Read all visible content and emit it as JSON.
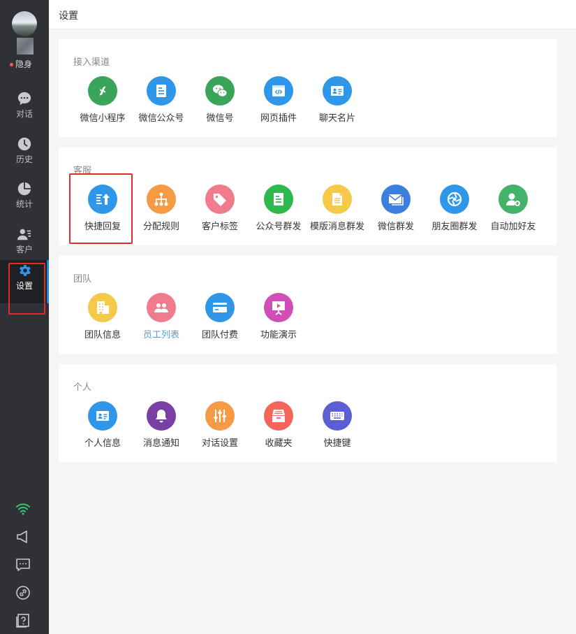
{
  "sidebar": {
    "status": "隐身",
    "items": [
      {
        "label": "对话",
        "icon": "chat-icon"
      },
      {
        "label": "历史",
        "icon": "clock-icon"
      },
      {
        "label": "统计",
        "icon": "pie-chart-icon"
      },
      {
        "label": "客户",
        "icon": "contacts-icon"
      },
      {
        "label": "设置",
        "icon": "gear-icon"
      }
    ],
    "bottom_icons": [
      "wifi-icon",
      "megaphone-icon",
      "message-icon",
      "link-icon",
      "help-icon"
    ],
    "colors": {
      "background": "#2f3136",
      "active": "#1f2024",
      "wifi": "#2ecc71"
    }
  },
  "header": {
    "title": "设置"
  },
  "sections": [
    {
      "title": "接入渠道",
      "items": [
        {
          "label": "微信小程序",
          "icon": "mini-program-icon",
          "color": "#3aa55a"
        },
        {
          "label": "微信公众号",
          "icon": "official-account-icon",
          "color": "#2f97ea"
        },
        {
          "label": "微信号",
          "icon": "wechat-icon",
          "color": "#3aa55a"
        },
        {
          "label": "网页插件",
          "icon": "web-plugin-icon",
          "color": "#2f97ea"
        },
        {
          "label": "聊天名片",
          "icon": "card-icon",
          "color": "#2f97ea"
        }
      ]
    },
    {
      "title": "客服",
      "items": [
        {
          "label": "快捷回复",
          "icon": "quick-reply-icon",
          "color": "#2f97ea"
        },
        {
          "label": "分配规则",
          "icon": "org-tree-icon",
          "color": "#f59a45"
        },
        {
          "label": "客户标签",
          "icon": "tag-icon",
          "color": "#f07b8d"
        },
        {
          "label": "公众号群发",
          "icon": "document-icon",
          "color": "#2fb84e"
        },
        {
          "label": "模版消息群发",
          "icon": "template-icon",
          "color": "#f5c94a"
        },
        {
          "label": "微信群发",
          "icon": "mail-icon",
          "color": "#3c7fe0"
        },
        {
          "label": "朋友圈群发",
          "icon": "aperture-icon",
          "color": "#2f97ea"
        },
        {
          "label": "自动加好友",
          "icon": "add-friend-icon",
          "color": "#43b36a"
        }
      ]
    },
    {
      "title": "团队",
      "items": [
        {
          "label": "团队信息",
          "icon": "building-icon",
          "color": "#f5c94a"
        },
        {
          "label": "员工列表",
          "icon": "staff-icon",
          "color": "#f07b8d",
          "link": true
        },
        {
          "label": "团队付费",
          "icon": "credit-card-icon",
          "color": "#2f97ea"
        },
        {
          "label": "功能演示",
          "icon": "presentation-icon",
          "color": "#cf4fb6"
        }
      ]
    },
    {
      "title": "个人",
      "items": [
        {
          "label": "个人信息",
          "icon": "id-card-icon",
          "color": "#2f97ea"
        },
        {
          "label": "消息通知",
          "icon": "bell-icon",
          "color": "#7a3fa3"
        },
        {
          "label": "对话设置",
          "icon": "sliders-icon",
          "color": "#f59a45"
        },
        {
          "label": "收藏夹",
          "icon": "archive-icon",
          "color": "#f2665a"
        },
        {
          "label": "快捷键",
          "icon": "keyboard-icon",
          "color": "#5b5fd3"
        }
      ]
    }
  ]
}
